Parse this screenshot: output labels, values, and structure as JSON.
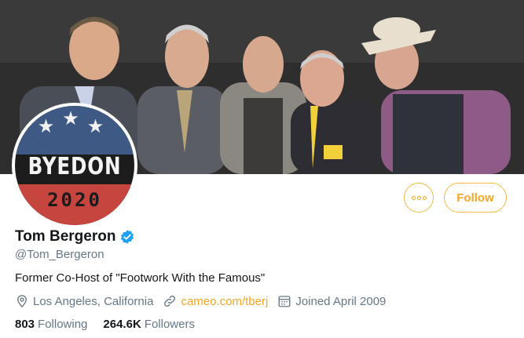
{
  "banner": {
    "alt": ""
  },
  "avatar": {
    "word": "BYEDON",
    "year": "2020",
    "stars": "★★★"
  },
  "actions": {
    "more_label": "",
    "follow_label": "Follow"
  },
  "profile": {
    "name": "Tom Bergeron",
    "handle": "@Tom_Bergeron",
    "bio": "Former Co-Host of \"Footwork With the Famous\"",
    "location": "Los Angeles, California",
    "website": "cameo.com/tberj",
    "joined": "Joined April 2009"
  },
  "stats": {
    "following_count": "803",
    "following_label": "Following",
    "followers_count": "264.6K",
    "followers_label": "Followers"
  },
  "colors": {
    "accent": "#f5a623",
    "verified": "#1da1f2",
    "muted": "#657786"
  }
}
